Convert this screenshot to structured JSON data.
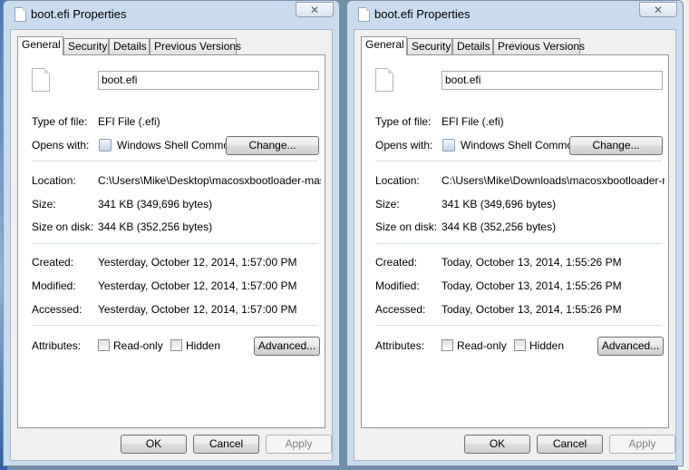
{
  "dialogs": [
    {
      "title": "boot.efi Properties",
      "close_glyph": "✕",
      "tabs": [
        "General",
        "Security",
        "Details",
        "Previous Versions"
      ],
      "file_name": "boot.efi",
      "type_label": "Type of file:",
      "type_value": "EFI File (.efi)",
      "opens_label": "Opens with:",
      "opens_value": "Windows Shell Commor",
      "change_button": "Change...",
      "location_label": "Location:",
      "location_value": "C:\\Users\\Mike\\Desktop\\macosxbootloader-master\\I",
      "size_label": "Size:",
      "size_value": "341 KB (349,696 bytes)",
      "disk_label": "Size on disk:",
      "disk_value": "344 KB (352,256 bytes)",
      "created_label": "Created:",
      "created_value": "Yesterday, October 12, 2014, 1:57:00 PM",
      "modified_label": "Modified:",
      "modified_value": "Yesterday, October 12, 2014, 1:57:00 PM",
      "accessed_label": "Accessed:",
      "accessed_value": "Yesterday, October 12, 2014, 1:57:00 PM",
      "attributes_label": "Attributes:",
      "readonly_label": "Read-only",
      "hidden_label": "Hidden",
      "advanced_button": "Advanced...",
      "ok_button": "OK",
      "cancel_button": "Cancel",
      "apply_button": "Apply"
    },
    {
      "title": "boot.efi Properties",
      "close_glyph": "✕",
      "tabs": [
        "General",
        "Security",
        "Details",
        "Previous Versions"
      ],
      "file_name": "boot.efi",
      "type_label": "Type of file:",
      "type_value": "EFI File (.efi)",
      "opens_label": "Opens with:",
      "opens_value": "Windows Shell Commor",
      "change_button": "Change...",
      "location_label": "Location:",
      "location_value": "C:\\Users\\Mike\\Downloads\\macosxbootloader-maste",
      "size_label": "Size:",
      "size_value": "341 KB (349,696 bytes)",
      "disk_label": "Size on disk:",
      "disk_value": "344 KB (352,256 bytes)",
      "created_label": "Created:",
      "created_value": "Today, October 13, 2014, 1:55:26 PM",
      "modified_label": "Modified:",
      "modified_value": "Today, October 13, 2014, 1:55:26 PM",
      "accessed_label": "Accessed:",
      "accessed_value": "Today, October 13, 2014, 1:55:26 PM",
      "attributes_label": "Attributes:",
      "readonly_label": "Read-only",
      "hidden_label": "Hidden",
      "advanced_button": "Advanced...",
      "ok_button": "OK",
      "cancel_button": "Cancel",
      "apply_button": "Apply"
    }
  ],
  "icons": {
    "title": "document-icon",
    "file": "file-icon",
    "program": "shell-program-icon",
    "close": "close-icon"
  },
  "colors": {
    "frame": "#c9dcef",
    "panel": "#ffffff",
    "client": "#f0f0f0"
  }
}
